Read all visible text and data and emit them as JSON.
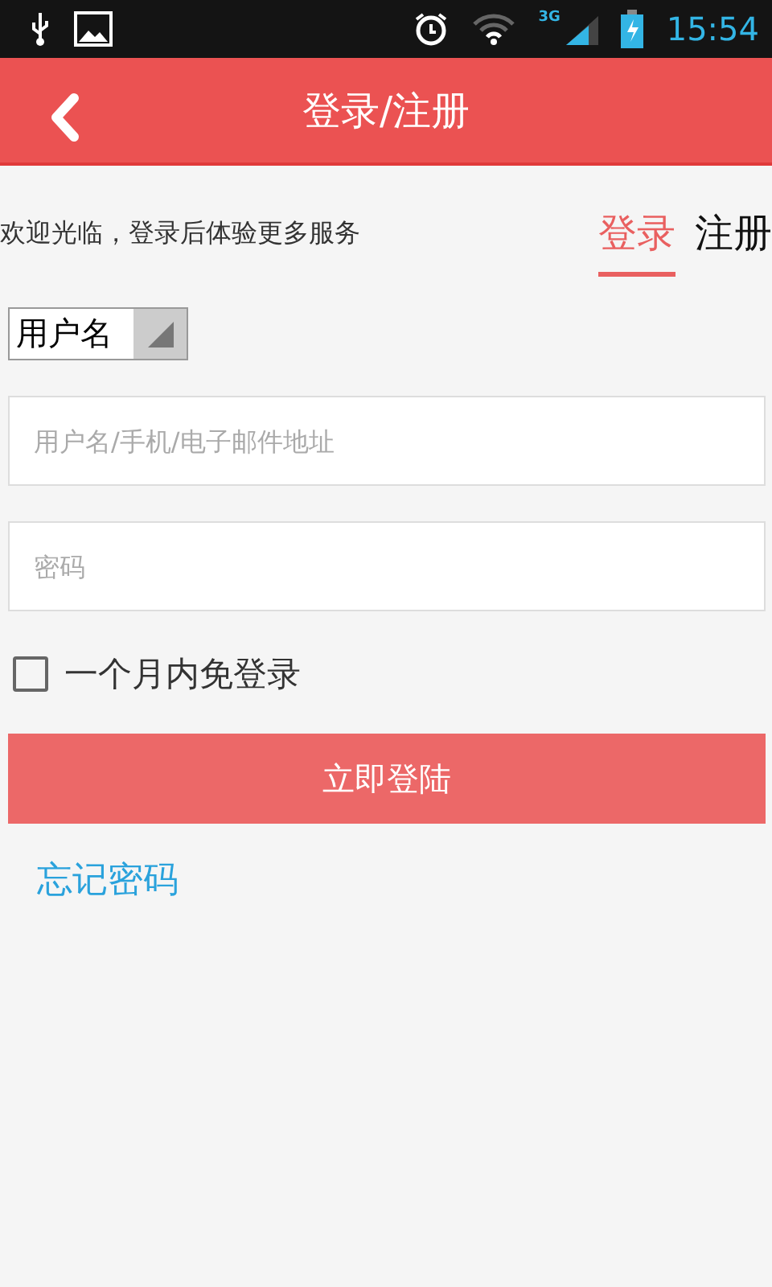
{
  "status_bar": {
    "time": "15:54",
    "network": "3G"
  },
  "header": {
    "title": "登录/注册"
  },
  "welcome": "欢迎光临，登录后体验更多服务",
  "tabs": [
    {
      "label": "登录",
      "selected": true
    },
    {
      "label": "注册",
      "selected": false
    }
  ],
  "account_type": {
    "value": "用户名"
  },
  "username": {
    "placeholder": "用户名/手机/电子邮件地址"
  },
  "password": {
    "placeholder": "密码"
  },
  "remember": {
    "label": "一个月内免登录",
    "checked": false
  },
  "login_button": "立即登陆",
  "forgot_link": "忘记密码"
}
